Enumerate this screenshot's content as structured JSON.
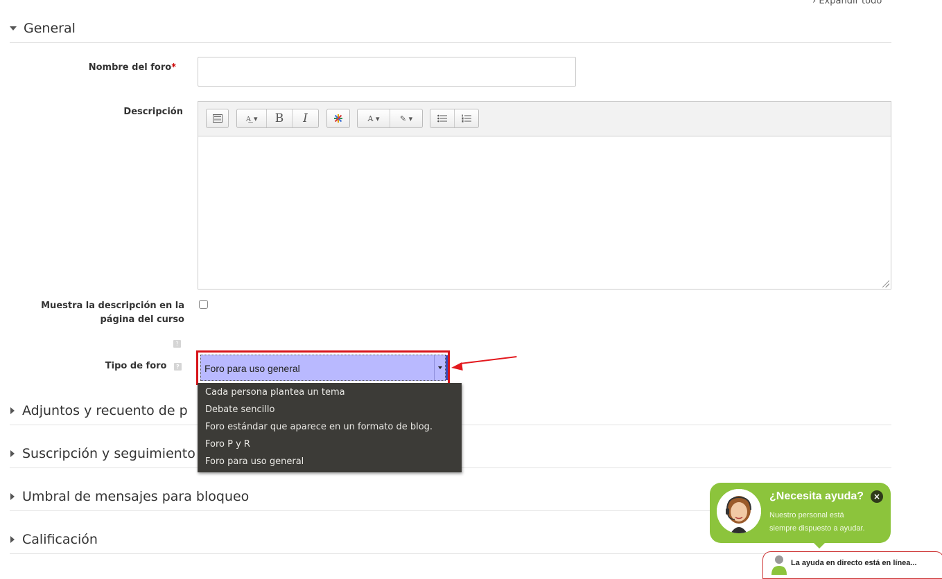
{
  "expand_all": "Expandir todo",
  "sections": {
    "general": "General",
    "attachments": "Adjuntos y recuento de p",
    "subscription": "Suscripción y seguimiento",
    "threshold": "Umbral de mensajes para bloqueo",
    "grading": "Calificación"
  },
  "form": {
    "forum_name_label": "Nombre del foro",
    "required_mark": "*",
    "forum_name_value": "",
    "description_label": "Descripción",
    "show_description_label_line1": "Muestra la descripción en la",
    "show_description_label_line2": "página del curso",
    "show_description_checked": false,
    "forum_type_label": "Tipo de foro",
    "forum_type_selected": "Foro para uso general",
    "help_glyph": "?"
  },
  "dropdown_options": [
    "Cada persona plantea un tema",
    "Debate sencillo",
    "Foro estándar que aparece en un formato de blog.",
    "Foro P y R",
    "Foro para uso general"
  ],
  "help_widget": {
    "title": "¿Necesita ayuda?",
    "line1": "Nuestro personal está",
    "line2": "siempre dispuesto a ayudar.",
    "close": "×",
    "chat_tab": "La ayuda en directo está en línea..."
  },
  "colors": {
    "select_bg": "#b9b9ff",
    "annotation_red": "#e3191e",
    "dropdown_bg": "#3c3b37",
    "bubble_green": "#8cc43c"
  }
}
